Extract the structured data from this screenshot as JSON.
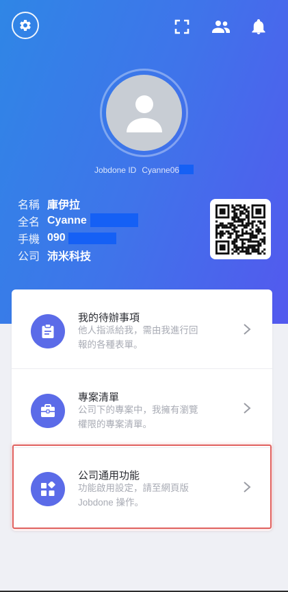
{
  "header": {
    "jobdone_id_label": "Jobdone ID",
    "jobdone_id_value": "Cyanne06"
  },
  "profile": {
    "rows": [
      {
        "label": "名稱",
        "value": "庫伊拉"
      },
      {
        "label": "全名",
        "value": "Cyanne"
      },
      {
        "label": "手機",
        "value": "090"
      },
      {
        "label": "公司",
        "value": "沛米科技"
      }
    ]
  },
  "menu": {
    "items": [
      {
        "title": "我的待辦事項",
        "desc_line1": "他人指派給我，需由我進行回",
        "desc_line2": "報的各種表單。",
        "icon": "clipboard-icon"
      },
      {
        "title": "專案清單",
        "desc_line1": "公司下的專案中，我擁有瀏覽",
        "desc_line2": "權限的專案清單。",
        "icon": "briefcase-icon"
      },
      {
        "title": "公司通用功能",
        "desc_line1": "功能啟用設定，請至網頁版",
        "desc_line2": "Jobdone 操作。",
        "icon": "widgets-icon"
      }
    ]
  },
  "colors": {
    "gradient_start": "#2f86e6",
    "gradient_end": "#5359ee",
    "accent_icon_bg": "#5b6be8",
    "redaction": "#1560f5",
    "highlight_border": "#e0615f"
  }
}
